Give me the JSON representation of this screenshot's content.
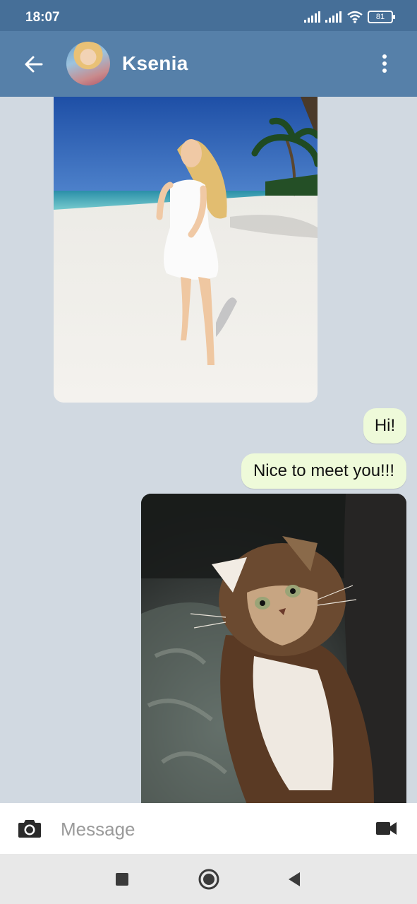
{
  "status_bar": {
    "time": "18:07",
    "battery": "81",
    "icons": [
      "signal-icon",
      "signal-icon",
      "wifi-icon",
      "battery-icon"
    ]
  },
  "header": {
    "title": "Ksenia",
    "icons": [
      "back-arrow-icon",
      "avatar",
      "more-vert-icon"
    ]
  },
  "messages": [
    {
      "type": "photo",
      "from": "them",
      "subject": "beach"
    },
    {
      "type": "text",
      "from": "me",
      "text": "Hi!"
    },
    {
      "type": "text",
      "from": "me",
      "text": "Nice to meet you!!!"
    },
    {
      "type": "photo",
      "from": "me",
      "subject": "kitten"
    }
  ],
  "composer": {
    "placeholder": "Message",
    "icons": [
      "camera-icon",
      "video-camera-icon"
    ]
  },
  "nav_bar": {
    "icons": [
      "recents-square-icon",
      "home-circle-icon",
      "back-triangle-icon"
    ]
  },
  "colors": {
    "status_bar": "#466f98",
    "app_bar": "#5680a9",
    "chat_background": "#d1d9e1",
    "outgoing_bubble": "#eefad9"
  }
}
